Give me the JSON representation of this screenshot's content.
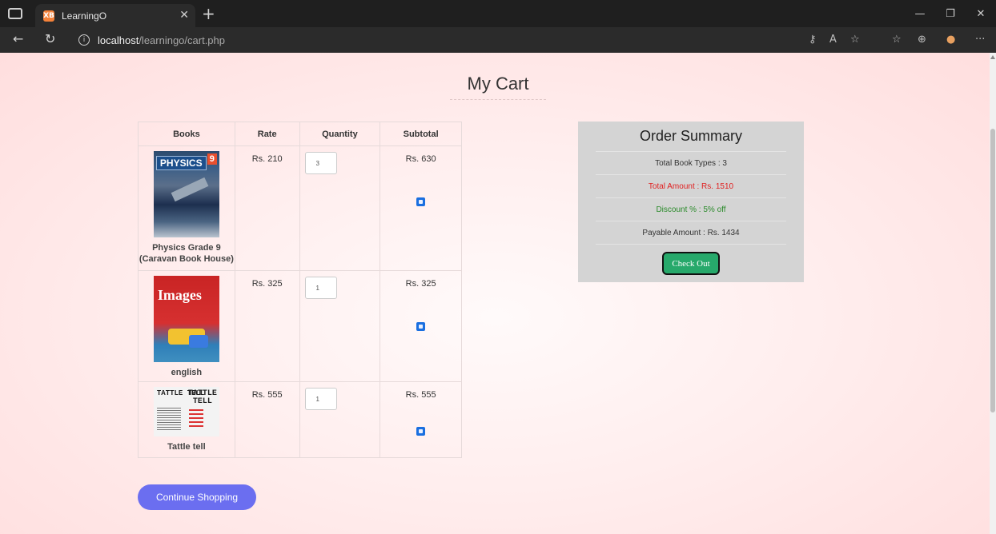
{
  "browser": {
    "tab_title": "LearningO",
    "tab_favicon": "XB",
    "url_host": "localhost",
    "url_path": "/learningo/cart.php"
  },
  "page": {
    "title": "My Cart"
  },
  "cart": {
    "headers": {
      "books": "Books",
      "rate": "Rate",
      "quantity": "Quantity",
      "subtotal": "Subtotal"
    },
    "items": [
      {
        "name": "Physics Grade 9 (Caravan Book House)",
        "rate": "Rs. 210",
        "quantity": "3",
        "subtotal": "Rs. 630",
        "cover_icon": "physics-book-cover",
        "cover_title": "PHYSICS",
        "cover_badge": "9"
      },
      {
        "name": "english",
        "rate": "Rs. 325",
        "quantity": "1",
        "subtotal": "Rs. 325",
        "cover_icon": "english-book-cover",
        "cover_title": "Images"
      },
      {
        "name": "Tattle tell",
        "rate": "Rs. 555",
        "quantity": "1",
        "subtotal": "Rs. 555",
        "cover_icon": "tattle-tell-book-cover",
        "cover_title_left": "TATTLE TELL",
        "cover_title_right": "TATTLE TELL"
      }
    ]
  },
  "summary": {
    "title": "Order Summary",
    "book_types": "Total Book Types : 3",
    "total_amount": "Total Amount : Rs. 1510",
    "discount": "Discount % : 5% off",
    "payable": "Payable Amount : Rs. 1434",
    "checkout_label": "Check Out"
  },
  "continue_label": "Continue Shopping",
  "colors": {
    "accent_button": "#6b6ef0",
    "checkout_button": "#27a96b",
    "trash_icon": "#1a6fe0",
    "total_red": "#e02020",
    "discount_green": "#2a8a2a"
  }
}
